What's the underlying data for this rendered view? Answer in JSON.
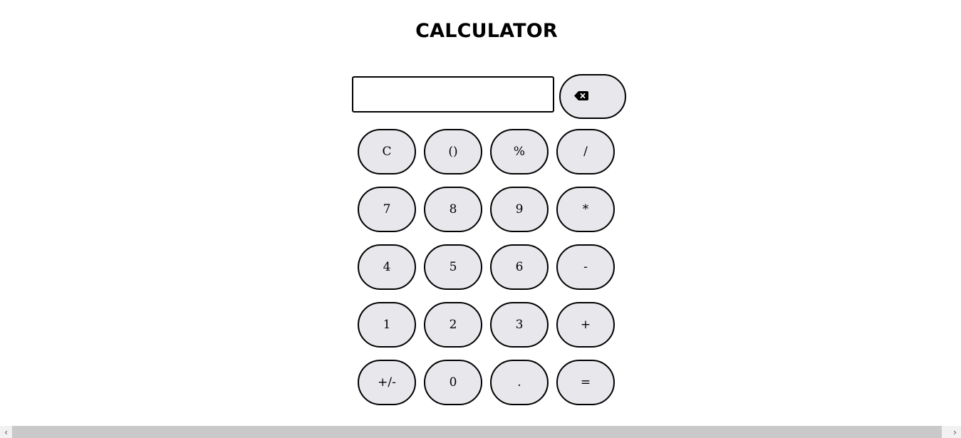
{
  "title": "CALCULATOR",
  "display": {
    "value": "",
    "placeholder": ""
  },
  "backspace": {
    "icon": "backspace-icon"
  },
  "keys": [
    {
      "label": "C",
      "name": "clear-button"
    },
    {
      "label": "()",
      "name": "parentheses-button"
    },
    {
      "label": "%",
      "name": "percent-button"
    },
    {
      "label": "/",
      "name": "divide-button"
    },
    {
      "label": "7",
      "name": "digit-7-button"
    },
    {
      "label": "8",
      "name": "digit-8-button"
    },
    {
      "label": "9",
      "name": "digit-9-button"
    },
    {
      "label": "*",
      "name": "multiply-button"
    },
    {
      "label": "4",
      "name": "digit-4-button"
    },
    {
      "label": "5",
      "name": "digit-5-button"
    },
    {
      "label": "6",
      "name": "digit-6-button"
    },
    {
      "label": "-",
      "name": "subtract-button"
    },
    {
      "label": "1",
      "name": "digit-1-button"
    },
    {
      "label": "2",
      "name": "digit-2-button"
    },
    {
      "label": "3",
      "name": "digit-3-button"
    },
    {
      "label": "+",
      "name": "add-button"
    },
    {
      "label": "+/-",
      "name": "negate-button"
    },
    {
      "label": "0",
      "name": "digit-0-button"
    },
    {
      "label": ".",
      "name": "decimal-button"
    },
    {
      "label": "=",
      "name": "equals-button"
    }
  ],
  "scrollbar": {
    "left_arrow": "chevron-left-icon",
    "right_arrow": "chevron-right-icon"
  },
  "colors": {
    "key_background": "#e8e8ec",
    "border": "#000000",
    "scrollbar_thumb": "#c9c9c9"
  }
}
